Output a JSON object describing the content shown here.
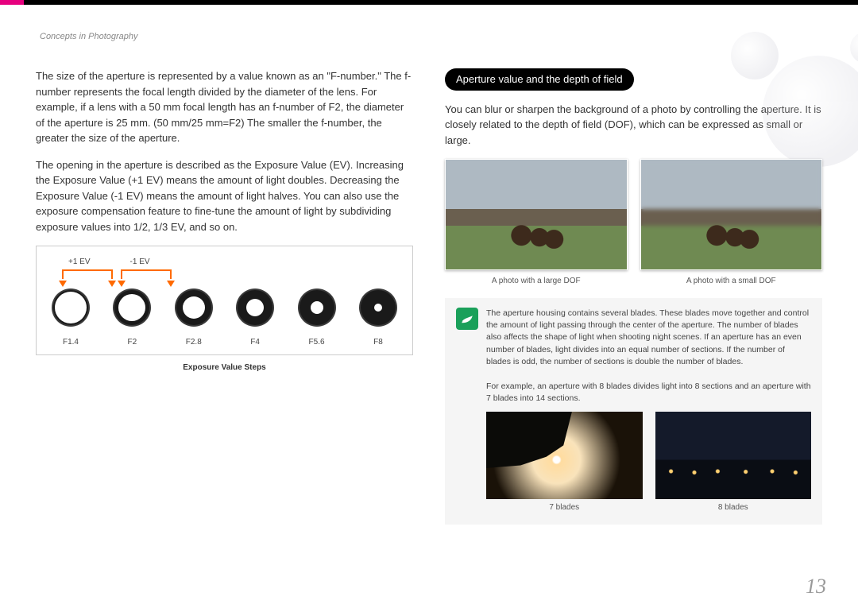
{
  "breadcrumb": "Concepts in Photography",
  "page_number": "13",
  "left": {
    "p1": "The size of the aperture is represented by a value known as an \"F-number.\" The f-number represents the focal length divided by the diameter of the lens. For example, if a lens with a 50 mm focal length has an f-number of F2, the diameter of the aperture is 25 mm. (50 mm/25 mm=F2) The smaller the f-number, the greater the size of the aperture.",
    "p2": "The opening in the aperture is described as the Exposure Value (EV). Increasing the Exposure Value (+1 EV) means the amount of light doubles. Decreasing the Exposure Value (-1 EV) means the amount of light halves. You can also use the exposure compensation feature to fine-tune the amount of light by subdividing exposure values into 1/2, 1/3 EV, and so on."
  },
  "ev_diagram": {
    "top_labels": [
      "+1 EV",
      "-1 EV"
    ],
    "stops": [
      "F1.4",
      "F2",
      "F2.8",
      "F4",
      "F5.6",
      "F8"
    ],
    "inner_radii": [
      20,
      17,
      14,
      11,
      8,
      5
    ],
    "caption": "Exposure Value Steps"
  },
  "right": {
    "section_title": "Aperture value and the depth of field",
    "intro": "You can blur or sharpen the background of a photo by controlling the aperture. It is closely related to the depth of field (DOF), which can be expressed as small or large.",
    "dof_captions": [
      "A photo with a large DOF",
      "A photo with a small DOF"
    ],
    "note_p1": "The aperture housing contains several blades. These blades move together and control the amount of light passing through the center of the aperture. The number of blades also affects the shape of light when shooting night scenes. If an aperture has an even number of blades, light divides into an equal number of sections. If the number of blades is odd, the number of sections is double the number of blades.",
    "note_p2": "For example, an aperture with 8 blades divides light into 8 sections and an aperture with 7 blades into 14 sections.",
    "blade_captions": [
      "7 blades",
      "8 blades"
    ]
  },
  "chart_data": {
    "type": "table",
    "title": "Exposure Value Steps",
    "categories": [
      "F1.4",
      "F2",
      "F2.8",
      "F4",
      "F5.6",
      "F8"
    ],
    "note": "Diagram shows aperture openings decreasing in size from F1.4 to F8; arrows indicate +1 EV (one stop wider) and -1 EV (one stop narrower)."
  }
}
